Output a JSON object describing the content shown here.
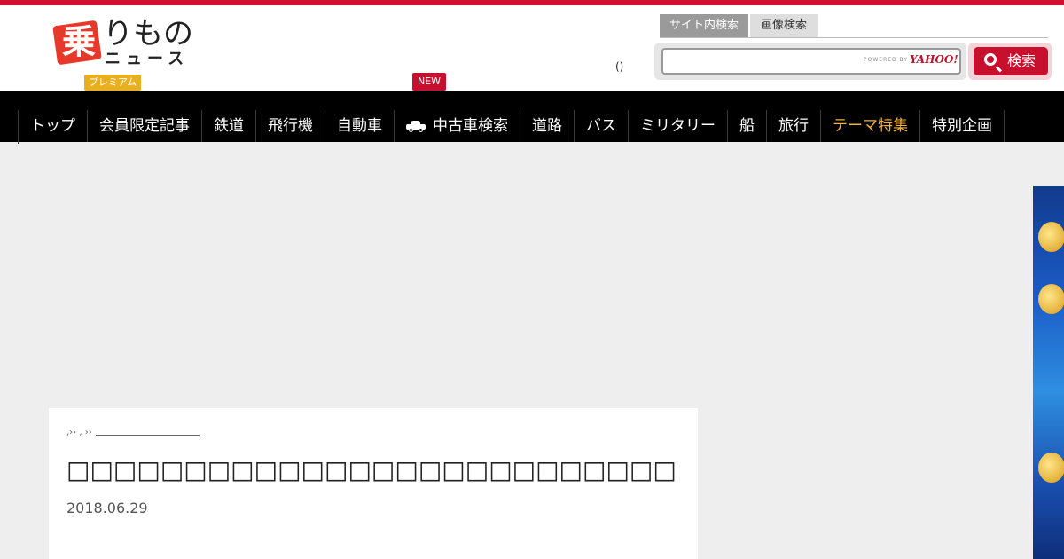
{
  "header": {
    "logo_mark": "乗",
    "logo_line1": "りもの",
    "logo_line2": "ニュース",
    "premium_badge": "プレミアム",
    "new_badge": "NEW",
    "paren_text": "()"
  },
  "search": {
    "tabs": [
      "サイト内検索",
      "画像検索"
    ],
    "placeholder": "",
    "powered_by": "POWERED BY",
    "provider": "YAHOO!",
    "button_label": "検索"
  },
  "nav": {
    "items": [
      {
        "label": "トップ",
        "highlight": false
      },
      {
        "label": "会員限定記事",
        "highlight": false
      },
      {
        "label": "鉄道",
        "highlight": false
      },
      {
        "label": "飛行機",
        "highlight": false
      },
      {
        "label": "自動車",
        "highlight": false
      },
      {
        "label": "中古車検索",
        "highlight": false,
        "icon": "car-icon"
      },
      {
        "label": "道路",
        "highlight": false
      },
      {
        "label": "バス",
        "highlight": false
      },
      {
        "label": "ミリタリー",
        "highlight": false
      },
      {
        "label": "船",
        "highlight": false
      },
      {
        "label": "旅行",
        "highlight": false
      },
      {
        "label": "テーマ特集",
        "highlight": true
      },
      {
        "label": "特別企画",
        "highlight": false
      }
    ]
  },
  "article": {
    "breadcrumb": ",›› , ››",
    "title": "□□□□□□□□□□□□□□□□□□□□□□□□□□□□□□□□□□□□□□□",
    "date": "2018.06.29"
  },
  "colors": {
    "brand_red": "#c8102e",
    "nav_bg": "#000000",
    "highlight": "#f5b335",
    "premium": "#e8b020"
  }
}
